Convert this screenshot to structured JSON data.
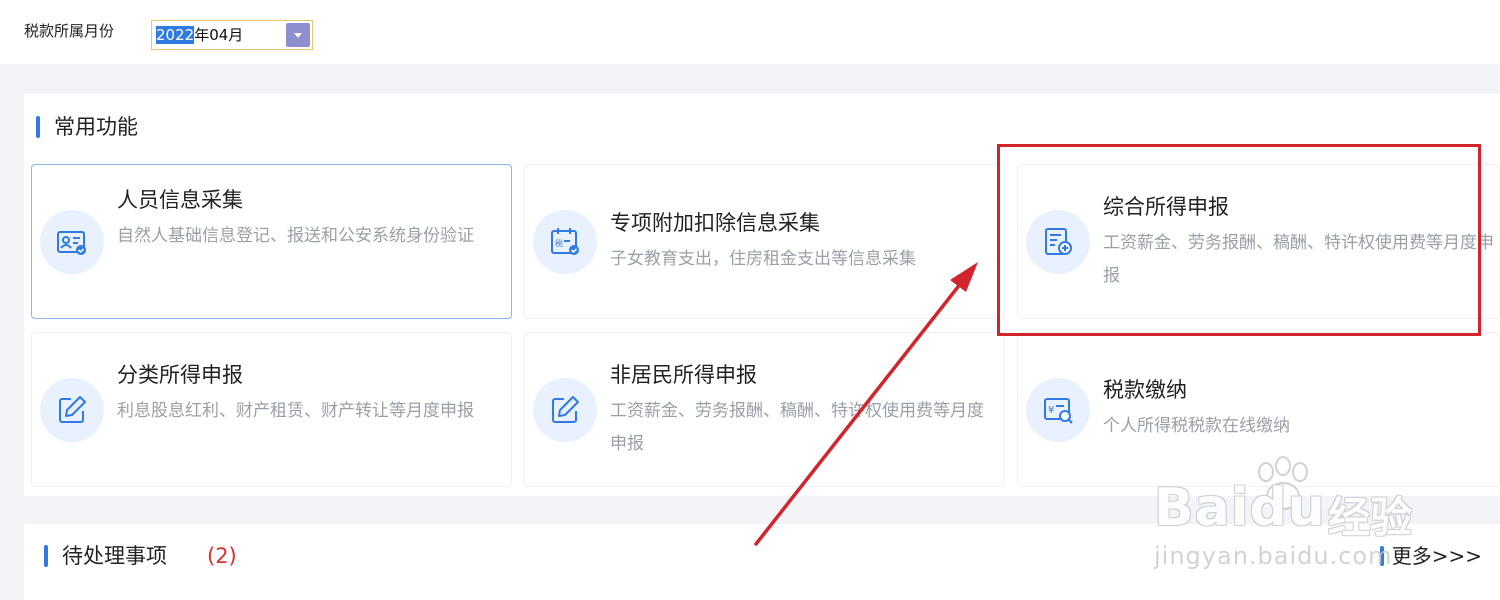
{
  "header": {
    "month_label": "税款所属月份",
    "month_value_selected": "2022",
    "month_value_rest": "年04月"
  },
  "common_functions": {
    "title": "常用功能",
    "cards": [
      {
        "title": "人员信息采集",
        "desc": "自然人基础信息登记、报送和公安系统身份验证",
        "icon": "id-card-check-icon"
      },
      {
        "title": "专项附加扣除信息采集",
        "desc": "子女教育支出，住房租金支出等信息采集",
        "icon": "tax-calendar-check-icon"
      },
      {
        "title": "综合所得申报",
        "desc": "工资薪金、劳务报酬、稿酬、特许权使用费等月度申报",
        "icon": "document-plus-icon"
      },
      {
        "title": "分类所得申报",
        "desc": "利息股息红利、财产租赁、财产转让等月度申报",
        "icon": "edit-square-icon"
      },
      {
        "title": "非居民所得申报",
        "desc": "工资薪金、劳务报酬、稿酬、特许权使用费等月度申报",
        "icon": "edit-square-icon"
      },
      {
        "title": "税款缴纳",
        "desc": "个人所得税税款在线缴纳",
        "icon": "yuan-search-icon"
      }
    ]
  },
  "pending": {
    "title": "待处理事项",
    "count": "(2)",
    "more": "更多>>>"
  },
  "watermark": {
    "brand": "Baidu",
    "cn": "经验",
    "url": "jingyan.baidu.com"
  },
  "annotation_color": "#d1242b",
  "accent_color": "#2f7ae5"
}
